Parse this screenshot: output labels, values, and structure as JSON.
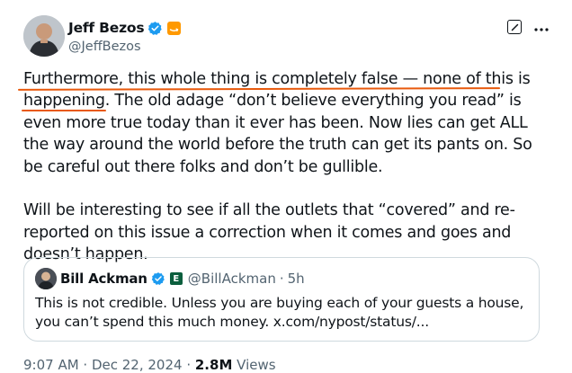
{
  "author": {
    "name": "Jeff Bezos",
    "handle": "@JeffBezos"
  },
  "tweet": {
    "paragraph1_highlight": "Furthermore, this whole thing is completely false — none of this is happening.",
    "paragraph1_rest": " The old adage “don’t believe everything you read” is even more true today than it ever has been. Now lies can get ALL the way around the world before the truth can get its pants on. So be careful out there folks and don’t be gullible.",
    "paragraph2": "Will be interesting to see if all the outlets that “covered” and re-reported on this issue a correction when it comes and goes and doesn’t happen."
  },
  "quote": {
    "name": "Bill Ackman",
    "handle": "@BillAckman",
    "separator": "·",
    "time": "5h",
    "affiliate_badge": "E",
    "text": "This is not credible. Unless you are buying each of your guests a house, you can’t spend this much money. x.com/nypost/status/..."
  },
  "footer": {
    "time": "9:07 AM",
    "separator1": " · ",
    "date": "Dec 22, 2024",
    "separator2": " · ",
    "views_count": "2.8M",
    "views_label": " Views"
  },
  "icons": {
    "verified": "verified-badge-icon",
    "affiliate": "amazon-affiliate-icon",
    "grok": "grok-icon",
    "more": "more-options-icon"
  },
  "colors": {
    "verified_blue": "#1d9bf0",
    "annotation_orange": "#e8590c",
    "secondary_text": "#536471"
  }
}
